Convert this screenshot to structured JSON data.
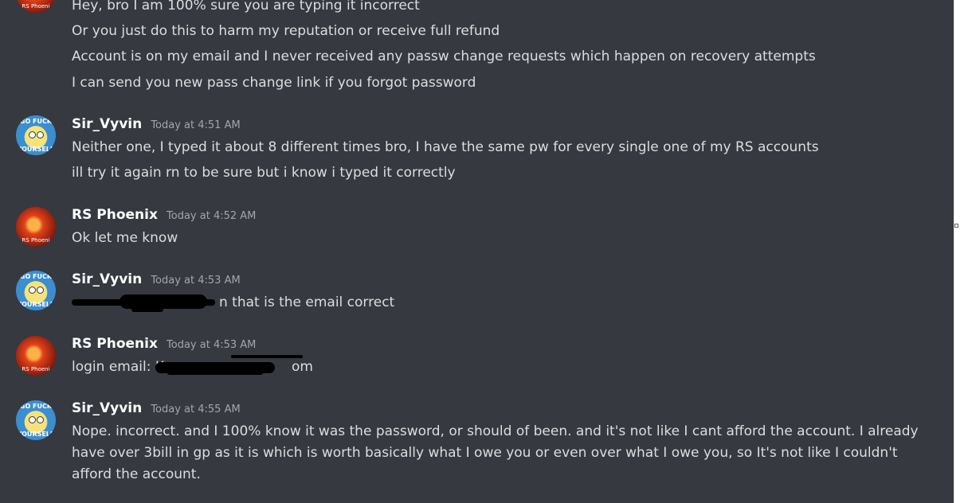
{
  "messages": {
    "group1": {
      "lines": [
        "Hey, bro I am 100% sure you are typing it incorrect",
        "Or you just do this to harm my reputation or receive full refund",
        "Account is on my email and I never received any passw change requests which happen on recovery attempts",
        "I can send you new pass change link if you forgot password"
      ],
      "avatar_text": "RS Phoeni"
    },
    "group2": {
      "author": "Sir_Vyvin",
      "timestamp": "Today at 4:51 AM",
      "lines": [
        "Neither one, I typed it about 8 different times bro, I have the same pw for every single one of my RS accounts",
        "ill try it again rn to be sure but i know i typed it correctly"
      ],
      "avatar_top": "GO FUCK",
      "avatar_bottom": "YOURSELF"
    },
    "group3": {
      "author": "RS Phoenix",
      "timestamp": "Today at 4:52 AM",
      "lines": [
        "Ok let me know"
      ],
      "avatar_text": "RS Phoeni"
    },
    "group4": {
      "author": "Sir_Vyvin",
      "timestamp": "Today at 4:53 AM",
      "lines": [
        "Ke n that is the email correct"
      ],
      "visible_suffix": "n that is the email correct",
      "avatar_top": "GO FUCK",
      "avatar_bottom": "YOURSELF"
    },
    "group5": {
      "author": "RS Phoenix",
      "timestamp": "Today at 4:53 AM",
      "prefix": "login email: K",
      "suffix": "om",
      "avatar_text": "RS Phoeni"
    },
    "group6": {
      "author": "Sir_Vyvin",
      "timestamp": "Today at 4:55 AM",
      "lines": [
        "Nope. incorrect. and I 100% know it was the password, or should of been. and it's not like I cant afford the account. I already",
        "have over 3bill in gp as it is which is worth basically what I owe you or even over what I owe you, so It's not like I couldn't",
        "afford the account."
      ],
      "avatar_top": "GO FUCK",
      "avatar_bottom": "YOURSELF"
    }
  },
  "colors": {
    "background": "#36393f",
    "text": "#dcddde",
    "timestamp": "#a3a6aa",
    "author": "#ffffff"
  }
}
